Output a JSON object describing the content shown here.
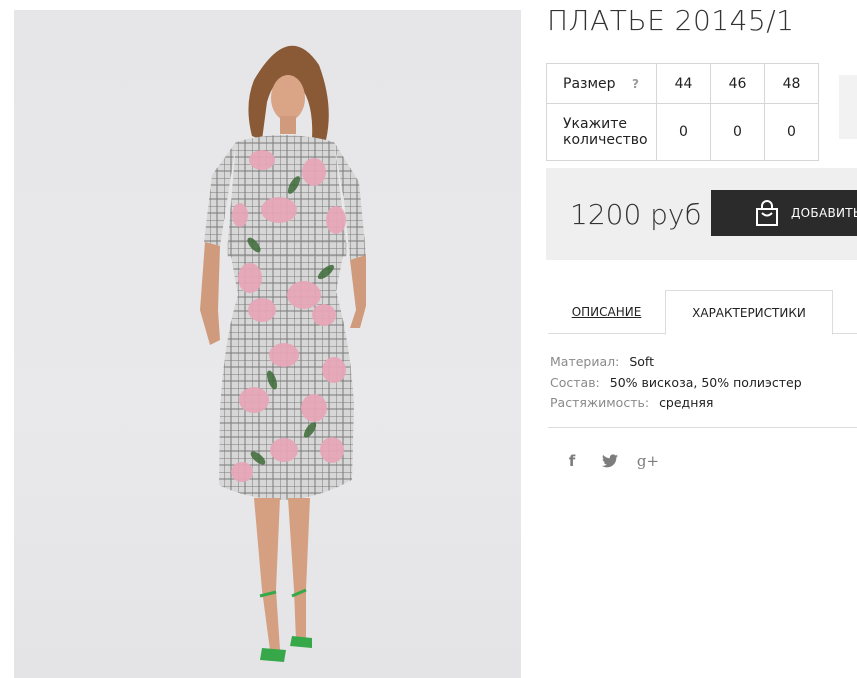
{
  "product": {
    "title": "ПЛАТЬЕ 20145/1",
    "photo_alt": ""
  },
  "sizes": {
    "size_label": "Размер",
    "help_glyph": "?",
    "qty_label_line1": "Укажите",
    "qty_label_line2": "количество",
    "columns": [
      {
        "size": "44",
        "qty": "0"
      },
      {
        "size": "46",
        "qty": "0"
      },
      {
        "size": "48",
        "qty": "0"
      }
    ]
  },
  "purchase": {
    "price": "1200 руб",
    "add_button_label": "ДОБАВИТЬ"
  },
  "tabs": {
    "description": "ОПИСАНИЕ",
    "characteristics": "ХАРАКТЕРИСТИКИ",
    "active": "characteristics"
  },
  "characteristics": [
    {
      "key": "Материал:",
      "value": "Soft"
    },
    {
      "key": "Состав:",
      "value": "50% вискоза, 50% полиэстер"
    },
    {
      "key": "Растяжимость:",
      "value": "средняя"
    }
  ],
  "social": {
    "facebook": "f",
    "twitter": "twitter-icon",
    "googleplus": "g+"
  },
  "colors": {
    "button_bg": "#2b2b2b",
    "panel_bg": "#efefef",
    "border": "#d6d6d6",
    "label_gray": "#8a8a8a"
  }
}
